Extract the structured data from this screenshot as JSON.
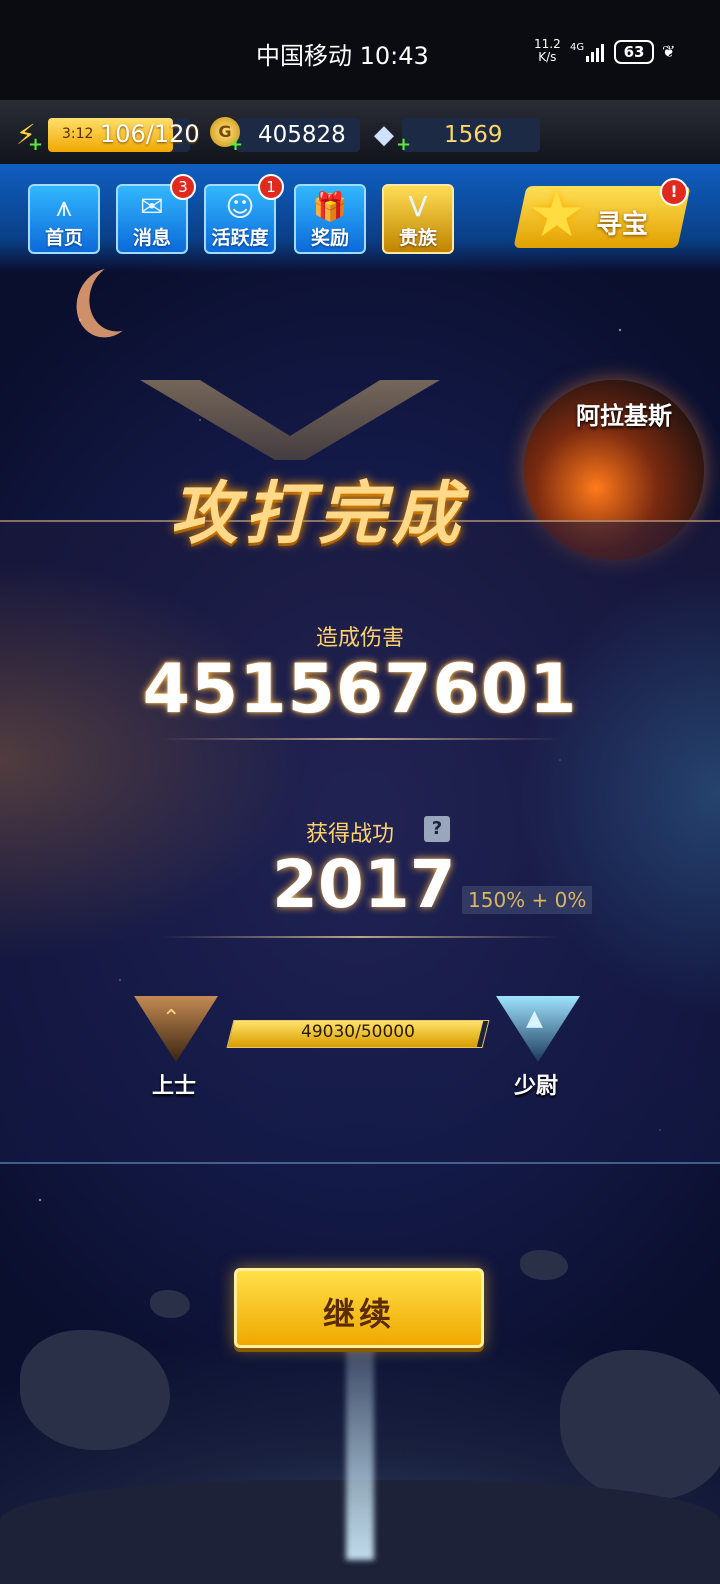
{
  "status_bar": {
    "carrier_time": "中国移动 10:43",
    "net_speed_value": "11.2",
    "net_speed_unit": "K/s",
    "net_type": "4G",
    "battery": "63"
  },
  "resources": {
    "energy_timer": "3:12",
    "energy_count": "106/120",
    "energy_fraction": 0.88,
    "coins": "405828",
    "gems": "1569"
  },
  "nav": {
    "items": [
      {
        "label": "首页",
        "icon": "home-icon",
        "badge": ""
      },
      {
        "label": "消息",
        "icon": "mail-icon",
        "badge": "3"
      },
      {
        "label": "活跃度",
        "icon": "smiley-icon",
        "badge": "1"
      },
      {
        "label": "奖励",
        "icon": "gift-icon",
        "badge": ""
      },
      {
        "label": "贵族",
        "icon": "vip-icon",
        "badge": ""
      }
    ],
    "treasure_label": "寻宝",
    "treasure_badge": "!"
  },
  "planet_name": "阿拉基斯",
  "result_title": "攻打完成",
  "damage": {
    "label": "造成伤害",
    "value": "451567601"
  },
  "merit": {
    "label": "获得战功",
    "help": "?",
    "value": "2017",
    "bonus": "150% + 0%"
  },
  "rank": {
    "current": "上士",
    "next": "少尉",
    "progress_text": "49030/50000",
    "progress_fraction": 0.9806
  },
  "continue_label": "继续",
  "colors": {
    "accent_gold": "#ffd36a",
    "nav_blue": "#0c6ad8",
    "badge_red": "#e02a1f"
  }
}
